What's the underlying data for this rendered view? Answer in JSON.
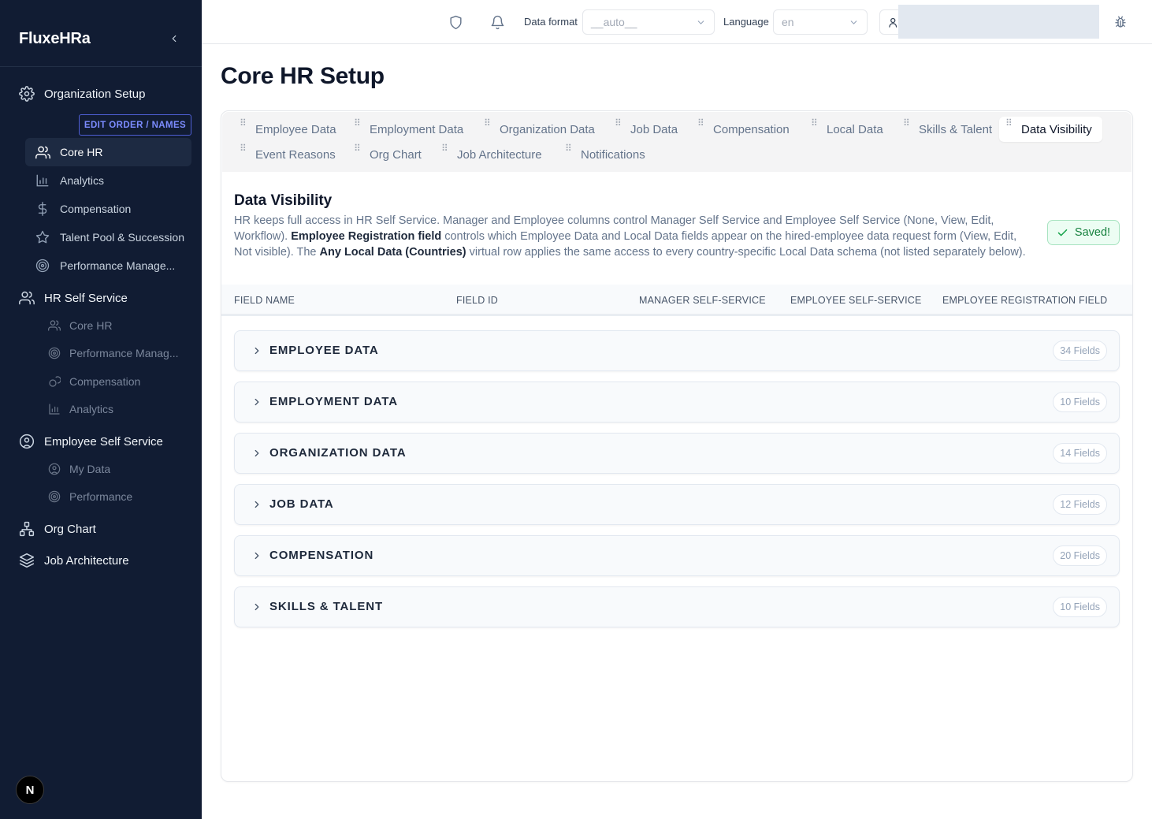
{
  "brand": "FluxeHRa",
  "sidebar": {
    "org_setup": "Organization Setup",
    "edit_order": "EDIT ORDER / NAMES",
    "org_items": [
      "Core HR",
      "Analytics",
      "Compensation",
      "Talent Pool & Succession",
      "Performance Manage..."
    ],
    "hr_self_service": "HR Self Service",
    "hr_items": [
      "Core HR",
      "Performance Manag...",
      "Compensation",
      "Analytics"
    ],
    "employee_self_service": "Employee Self Service",
    "ess_items": [
      "My Data",
      "Performance"
    ],
    "org_chart": "Org Chart",
    "job_architecture": "Job Architecture",
    "badge": "N"
  },
  "topbar": {
    "data_format_label": "Data format",
    "data_format_value": "__auto__",
    "language_label": "Language",
    "language_value": "en"
  },
  "page": {
    "title": "Core HR Setup",
    "tabs_row1": [
      "Employee Data",
      "Employment Data",
      "Organization Data",
      "Job Data",
      "Compensation",
      "Local Data",
      "Skills & Talent",
      "Data Visibility"
    ],
    "tabs_row2": [
      "Event Reasons",
      "Org Chart",
      "Job Architecture",
      "Notifications"
    ],
    "active_tab": "Data Visibility",
    "section_title": "Data Visibility",
    "desc": {
      "p1": "HR keeps full access in HR Self Service. Manager and Employee columns control Manager Self Service and Employee Self Service (None, View, Edit, Workflow). ",
      "b1": "Employee Registration field",
      "p2": " controls which Employee Data and Local Data fields appear on the hired-employee data request form (View, Edit, Not visible). The ",
      "b2": "Any Local Data (Countries)",
      "p3": " virtual row applies the same access to every country-specific Local Data schema (not listed separately below)."
    },
    "saved": "Saved!",
    "columns": [
      "FIELD NAME",
      "FIELD ID",
      "MANAGER SELF-SERVICE",
      "EMPLOYEE SELF-SERVICE",
      "EMPLOYEE REGISTRATION FIELD"
    ],
    "groups": [
      {
        "name": "EMPLOYEE DATA",
        "count": "34 Fields"
      },
      {
        "name": "EMPLOYMENT DATA",
        "count": "10 Fields"
      },
      {
        "name": "ORGANIZATION DATA",
        "count": "14 Fields"
      },
      {
        "name": "JOB DATA",
        "count": "12 Fields"
      },
      {
        "name": "COMPENSATION",
        "count": "20 Fields"
      },
      {
        "name": "SKILLS & TALENT",
        "count": "10 Fields"
      }
    ]
  }
}
